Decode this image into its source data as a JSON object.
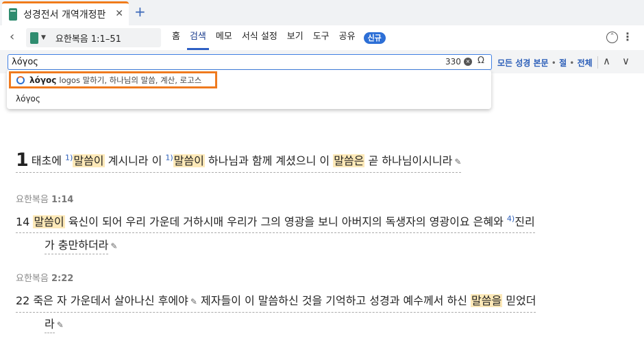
{
  "tab": {
    "title": "성경전서 개역개정판",
    "close": "✕",
    "add": "+"
  },
  "toolbar": {
    "back": "‹",
    "reference": "요한복음 1:1–51",
    "menu": [
      "홈",
      "검색",
      "메모",
      "서식 설정",
      "보기",
      "도구",
      "공유"
    ],
    "active_menu": "검색",
    "badge": "신규",
    "collapse": "⌃",
    "more": "⋮"
  },
  "search": {
    "value": "λόγος",
    "count": "330",
    "clear": "×",
    "omega": "Ω",
    "scope_all_text": "모든 성경 본문",
    "scope_verse": "절",
    "scope_all": "전체",
    "dot": "•",
    "up": "∧",
    "down": "∨"
  },
  "dropdown": {
    "suggestion_word": "λόγος",
    "suggestion_desc": "logos 말하기, 하나님의 말씀, 계산, 로고스",
    "second": "λόγος"
  },
  "colors": {
    "accent": "#2d5fc4",
    "tab_accent": "#f07b1a",
    "highlight": "#fde9b8",
    "suggestion_border": "#ef7a1e"
  },
  "content": {
    "v1": {
      "num": "1",
      "t1": "태초에 ",
      "n1": "1)",
      "h1": "말씀이",
      "t2": " 계시니라 이 ",
      "n2": "1)",
      "h2": "말씀이",
      "t3": " 하나님과 함께 계셨으니 이 ",
      "h3": "말씀은",
      "t4": " 곧 하나님이시니라"
    },
    "ref2_book": "요한복음",
    "ref2_ch": "1:14",
    "v14": {
      "num": "14",
      "h1": "말씀이",
      "t1": " 육신이 되어 우리 가운데 거하시매 우리가 그의 영광을 보니 아버지의 독생자의 영광이요 은혜와 ",
      "n1": "4)",
      "t2": "진리",
      "l2": "가 충만하더라"
    },
    "ref3_book": "요한복음",
    "ref3_ch": "2:22",
    "v22": {
      "num": "22",
      "t1": "죽은 자 가운데서 살아나신 후에야",
      "t2": " 제자들이 이 말씀하신 것을 기억하고 성경과 예수께서 하신 ",
      "h1": "말씀을",
      "t3": " 믿었더",
      "l2": "라"
    }
  }
}
